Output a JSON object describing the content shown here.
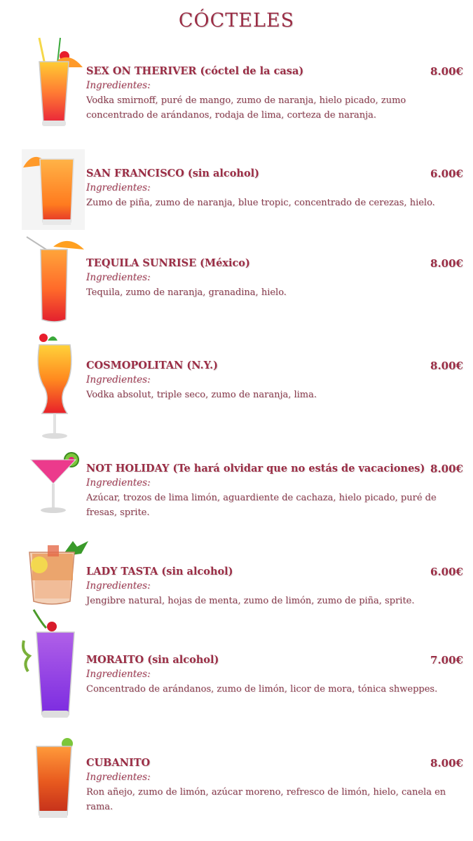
{
  "title": "CÓCTELES",
  "ingredients_label": "Ingredientes:",
  "items": [
    {
      "name": "SEX ON THERIVER (cóctel de la casa)",
      "price": "8.00€",
      "description": "Vodka smirnoff, puré de mango, zumo de naranja, hielo picado, zumo concentrado de arándanos, rodaja de lima, corteza de naranja.",
      "image": "sunset-cocktail-icon"
    },
    {
      "name": "SAN FRANCISCO (sin alcohol)",
      "price": "6.00€",
      "description": "Zumo de piña, zumo de naranja, blue tropic, concentrado de cerezas, hielo.",
      "image": "orange-cocktail-icon"
    },
    {
      "name": "TEQUILA SUNRISE (México)",
      "price": "8.00€",
      "description": "Tequila, zumo de naranja, granadina, hielo.",
      "image": "tequila-sunrise-icon"
    },
    {
      "name": "COSMOPOLITAN (N.Y.)",
      "price": "8.00€",
      "description": "Vodka absolut, triple seco, zumo de naranja, lima.",
      "image": "hurricane-glass-icon"
    },
    {
      "name": "NOT HOLIDAY (Te hará olvidar que no estás de vacaciones)",
      "price": "8.00€",
      "description": "Azúcar, trozos de lima limón, aguardiente de cachaza, hielo picado, puré de fresas, sprite.",
      "image": "martini-glass-icon"
    },
    {
      "name": "LADY TASTA (sin alcohol)",
      "price": "6.00€",
      "description": "Jengibre natural, hojas de menta, zumo de limón, zumo de piña, sprite.",
      "image": "iced-drink-icon"
    },
    {
      "name": "MORAITO (sin alcohol)",
      "price": "7.00€",
      "description": "Concentrado de arándanos, zumo de limón, licor de mora, tónica shweppes.",
      "image": "purple-cocktail-icon"
    },
    {
      "name": "CUBANITO",
      "price": "8.00€",
      "description": "Ron añejo, zumo de limón, azúcar moreno, refresco de limón, hielo, canela en rama.",
      "image": "cubanito-cocktail-icon"
    }
  ]
}
